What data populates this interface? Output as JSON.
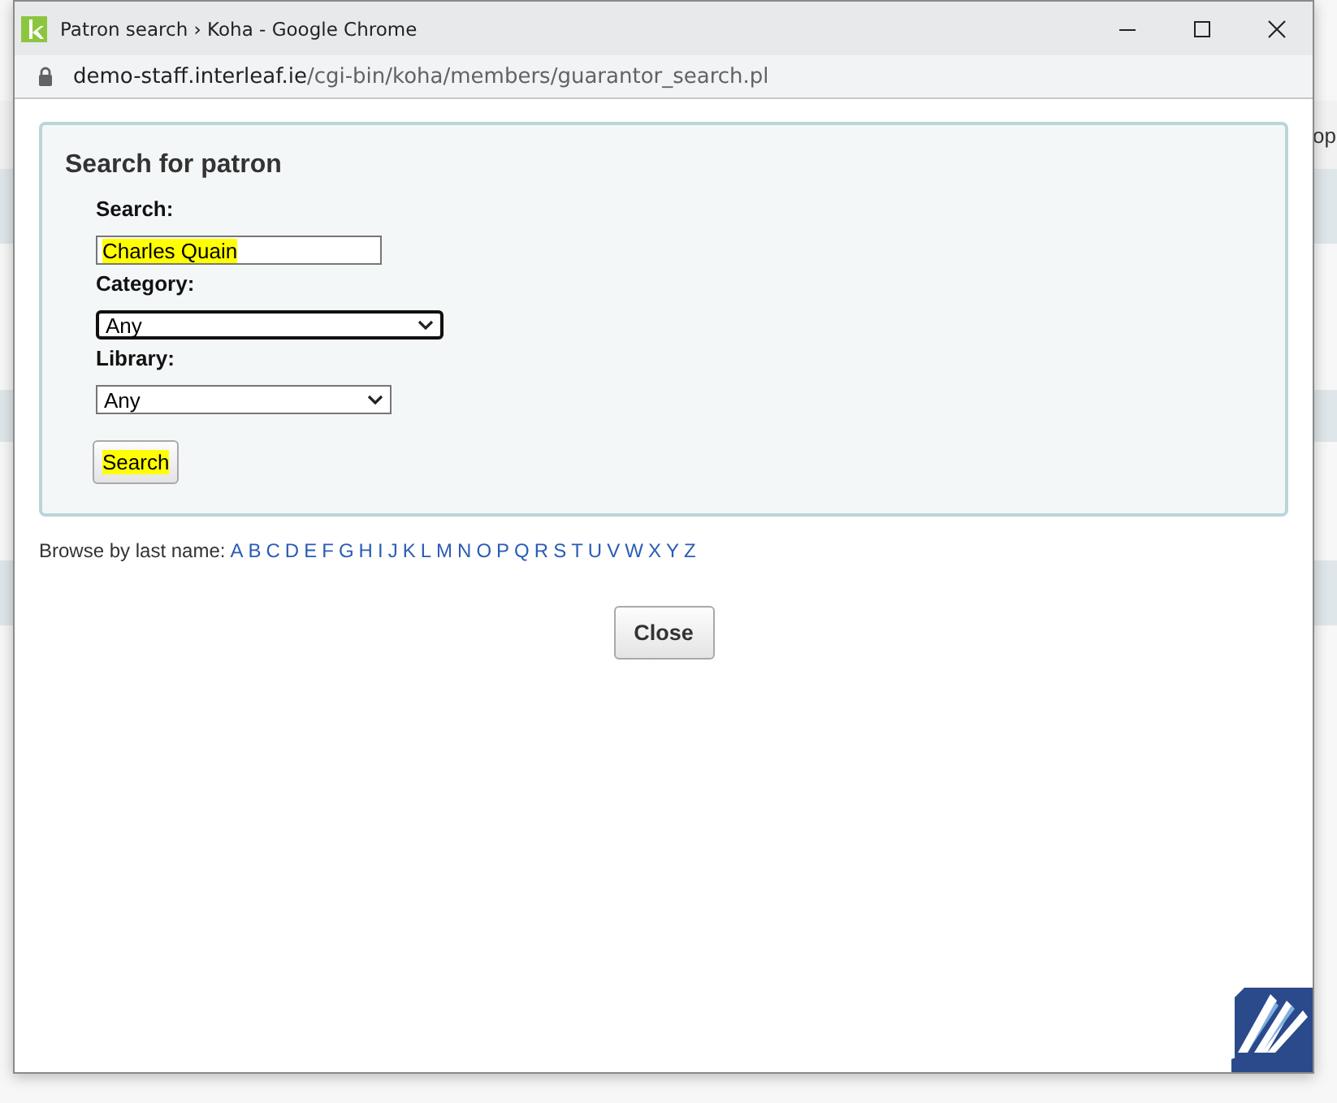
{
  "background_page": {
    "text": "op"
  },
  "window": {
    "title": "Patron search › Koha - Google Chrome",
    "address": {
      "domain": "demo-staff.interleaf.ie",
      "path": "/cgi-bin/koha/members/guarantor_search.pl"
    }
  },
  "search_form": {
    "heading": "Search for patron",
    "fields": [
      {
        "kind": "text",
        "label": "Search:",
        "value": "Charles Quain",
        "highlighted": true,
        "focused": false
      },
      {
        "kind": "select",
        "label": "Category:",
        "value": "Any",
        "highlighted": false,
        "focused": true
      },
      {
        "kind": "select",
        "label": "Library:",
        "value": "Any",
        "highlighted": false,
        "focused": false
      }
    ],
    "submit": {
      "label": "Search",
      "highlighted": true
    }
  },
  "browse": {
    "label": "Browse by last name:",
    "letters": [
      "A",
      "B",
      "C",
      "D",
      "E",
      "F",
      "G",
      "H",
      "I",
      "J",
      "K",
      "L",
      "M",
      "N",
      "O",
      "P",
      "Q",
      "R",
      "S",
      "T",
      "U",
      "V",
      "W",
      "X",
      "Y",
      "Z"
    ]
  },
  "close_button": {
    "label": "Close"
  }
}
